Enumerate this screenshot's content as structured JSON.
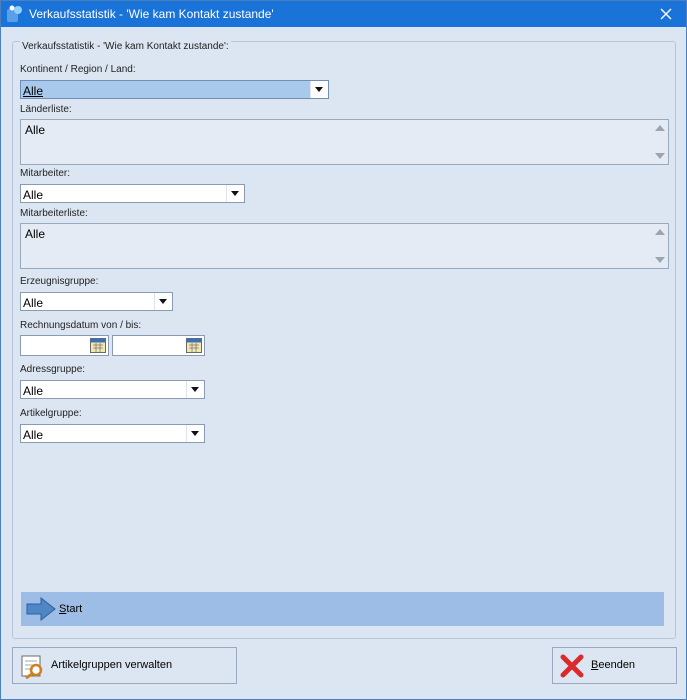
{
  "window": {
    "title": "Verkaufsstatistik - 'Wie kam Kontakt zustande'",
    "close_symbol": "✕"
  },
  "group": {
    "legend": "Verkaufsstatistik - 'Wie kam Kontakt zustande':"
  },
  "fields": {
    "kontinent": {
      "label": "Kontinent / Region / Land:",
      "value": "Alle"
    },
    "laenderliste": {
      "label": "Länderliste:",
      "value": "Alle"
    },
    "mitarbeiter": {
      "label": "Mitarbeiter:",
      "value": "Alle"
    },
    "mitarbeiterliste": {
      "label": "Mitarbeiterliste:",
      "value": "Alle"
    },
    "erzeugnisgruppe": {
      "label": "Erzeugnisgruppe:",
      "value": "Alle"
    },
    "rechnungsdatum": {
      "label": "Rechnungsdatum von / bis:",
      "from": "",
      "to": ""
    },
    "adressgruppe": {
      "label": "Adressgruppe:",
      "value": "Alle"
    },
    "artikelgruppe": {
      "label": "Artikelgruppe:",
      "value": "Alle"
    }
  },
  "start": {
    "mnemonic": "S",
    "rest": "tart",
    "icon": "arrow-right-icon"
  },
  "buttons": {
    "artikelgruppen": {
      "label": "Artikelgruppen verwalten",
      "icon": "manage-groups-icon"
    },
    "beenden": {
      "mnemonic": "B",
      "rest": "eenden",
      "icon": "red-x-icon"
    }
  },
  "colors": {
    "titlebar": "#1a73d8",
    "window_bg": "#dce6f2",
    "start_bar": "#9dbce6",
    "active_combo": "#a8c8ec"
  }
}
